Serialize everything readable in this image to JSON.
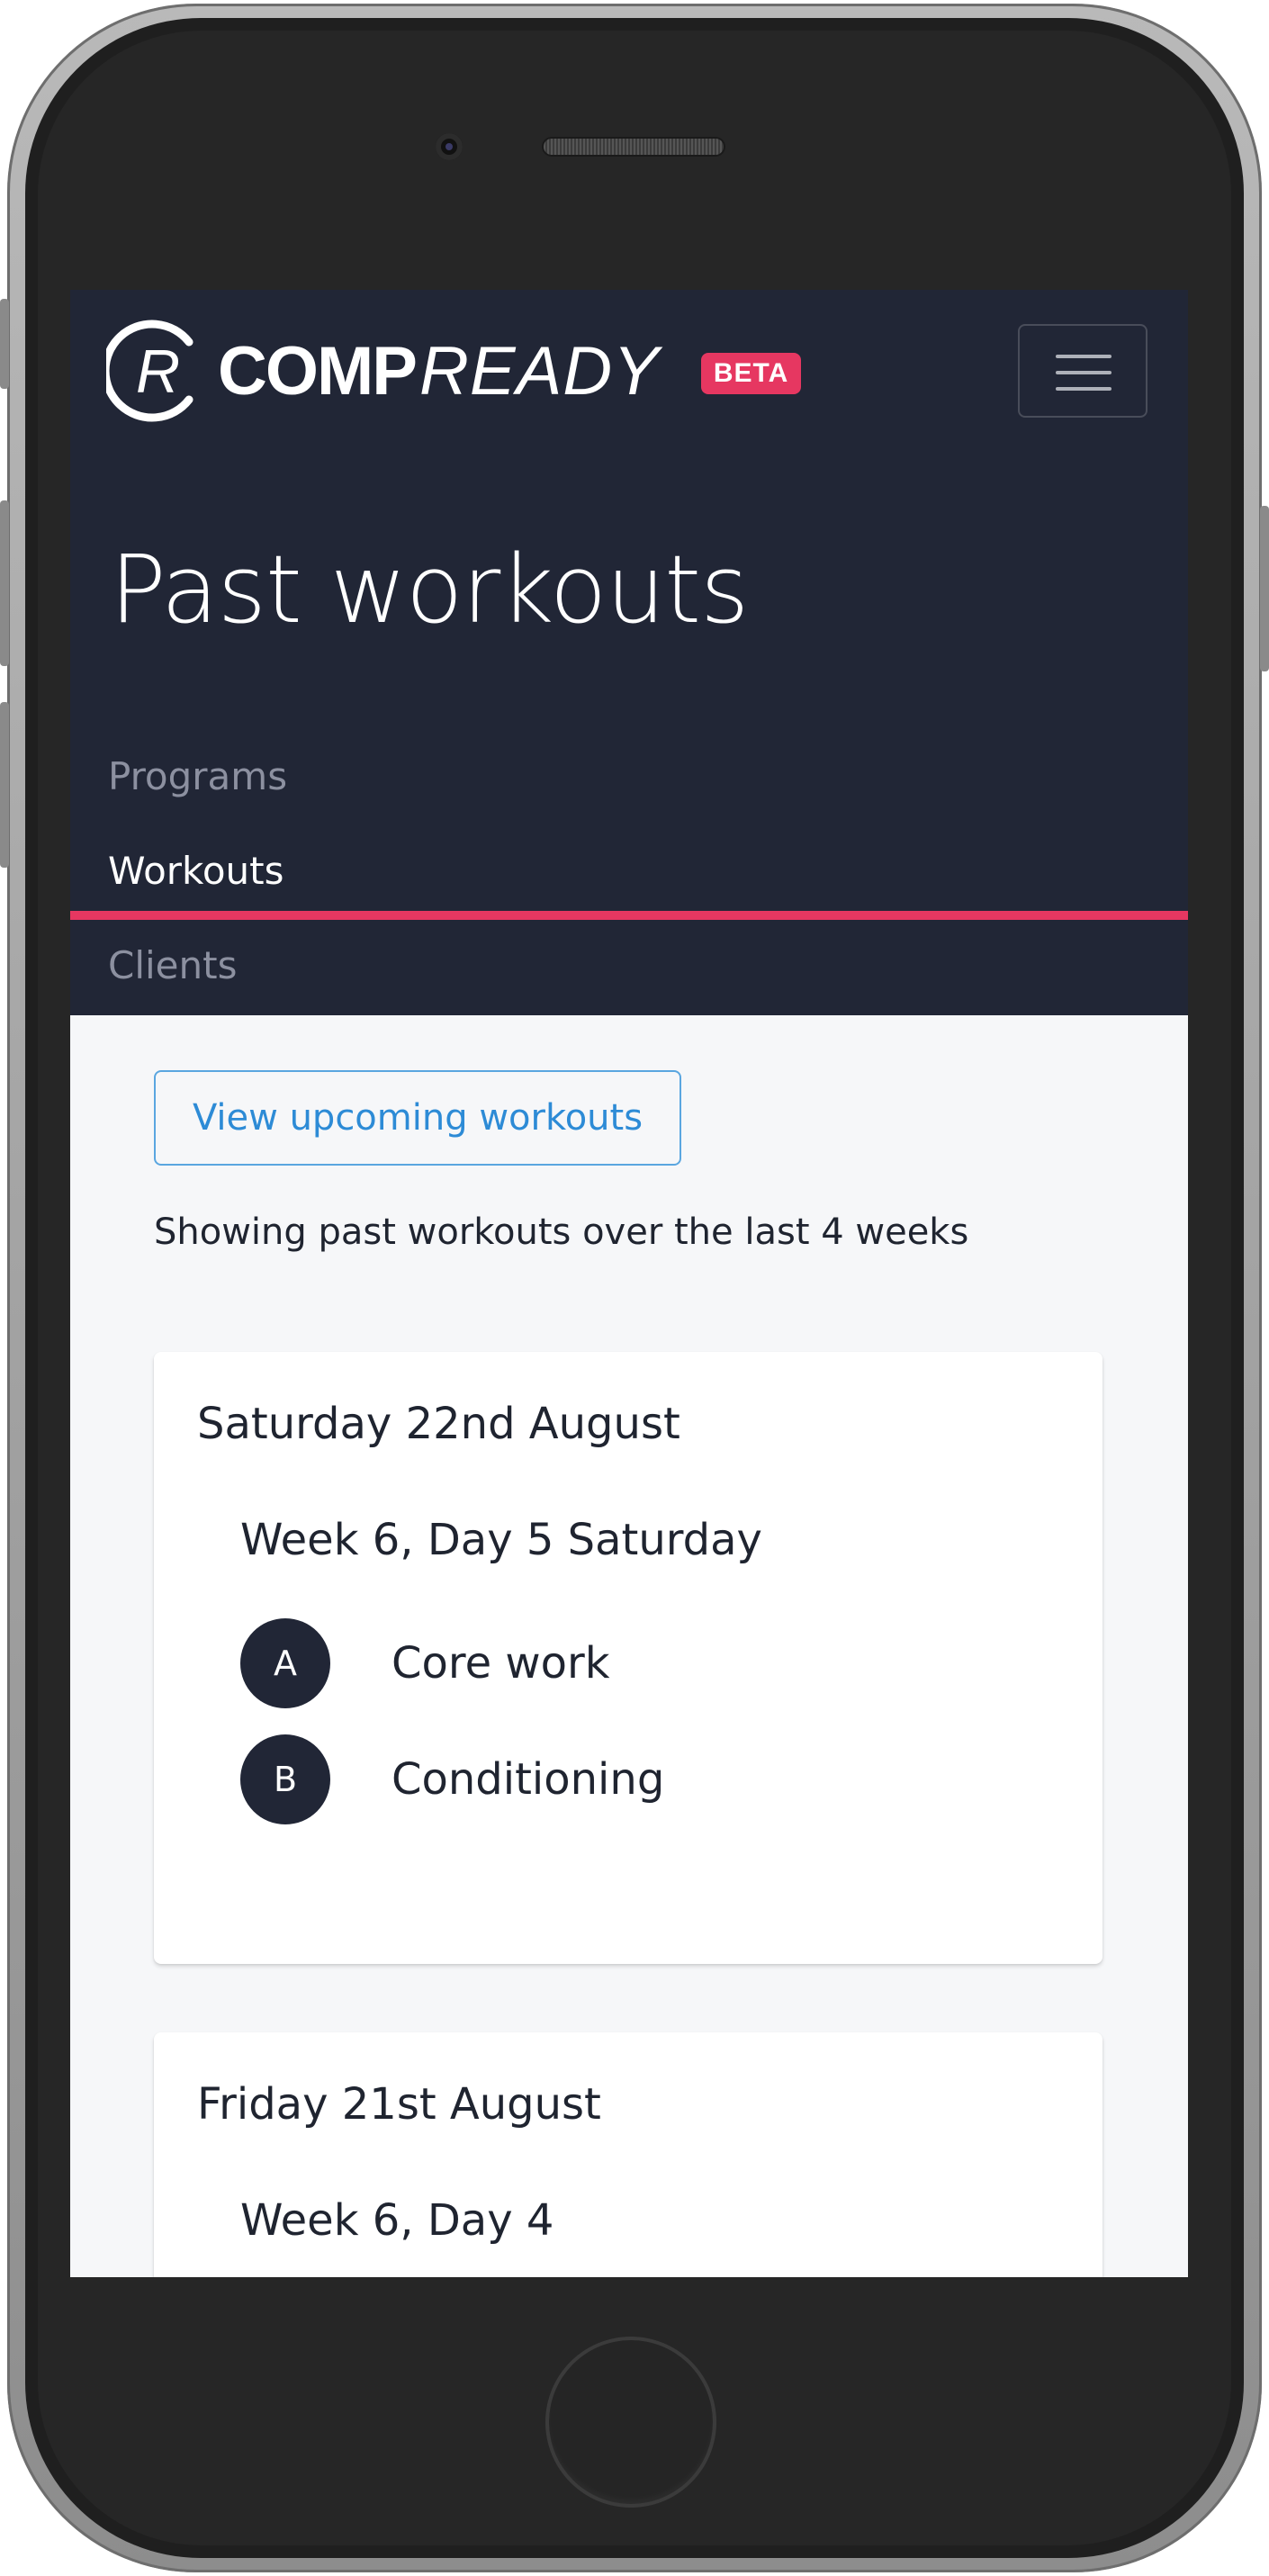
{
  "brand": {
    "comp": "COMP",
    "ready": "READY",
    "badge": "BETA"
  },
  "header": {
    "title": "Past workouts"
  },
  "nav": {
    "items": [
      {
        "label": "Programs",
        "active": false
      },
      {
        "label": "Workouts",
        "active": true
      },
      {
        "label": "Clients",
        "active": false
      }
    ]
  },
  "content": {
    "upcoming_button": "View upcoming workouts",
    "showing_text": "Showing past workouts over the last 4 weeks",
    "cards": [
      {
        "date": "Saturday 22nd August",
        "week": "Week 6, Day 5 Saturday",
        "exercises": [
          {
            "letter": "A",
            "name": "Core work"
          },
          {
            "letter": "B",
            "name": "Conditioning"
          }
        ]
      },
      {
        "date": "Friday 21st August",
        "week": "Week 6, Day 4",
        "exercises": []
      }
    ]
  },
  "colors": {
    "header_bg": "#212636",
    "accent": "#e63761",
    "link": "#2d8bd6",
    "page_bg": "#f6f7f9"
  }
}
